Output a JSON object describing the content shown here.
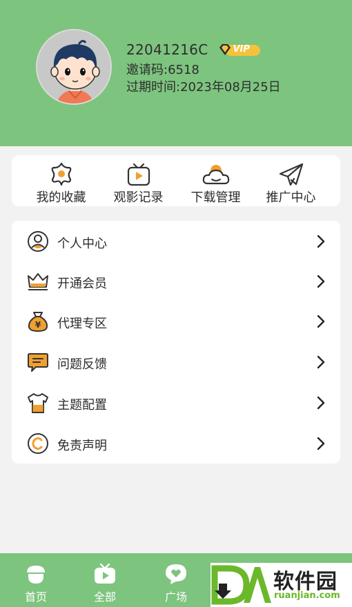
{
  "profile": {
    "user_id": "22041216C",
    "vip_label": "VIP",
    "invite_code": "邀请码:6518",
    "expire_text": "过期时间:2023年08月25日"
  },
  "quick_actions": [
    {
      "label": "我的收藏",
      "icon": "flower-star-icon"
    },
    {
      "label": "观影记录",
      "icon": "tv-play-icon"
    },
    {
      "label": "下载管理",
      "icon": "cloud-sun-icon"
    },
    {
      "label": "推广中心",
      "icon": "paper-plane-icon"
    }
  ],
  "menu": [
    {
      "label": "个人中心",
      "icon": "user-circle-icon"
    },
    {
      "label": "开通会员",
      "icon": "crown-icon"
    },
    {
      "label": "代理专区",
      "icon": "money-bag-icon"
    },
    {
      "label": "问题反馈",
      "icon": "chat-bubble-icon"
    },
    {
      "label": "主题配置",
      "icon": "tshirt-icon"
    },
    {
      "label": "免责声明",
      "icon": "copyright-icon"
    }
  ],
  "tabbar": [
    {
      "label": "首页",
      "icon": "acorn-home-icon"
    },
    {
      "label": "全部",
      "icon": "tv-icon"
    },
    {
      "label": "广场",
      "icon": "heart-bubble-icon"
    }
  ],
  "watermark": {
    "brand_cn": "软件园",
    "brand_en": "ruanjian.com"
  },
  "colors": {
    "header_green": "#7dc47f",
    "accent_orange": "#f0a030",
    "vip_gold": "#f5c23a"
  }
}
